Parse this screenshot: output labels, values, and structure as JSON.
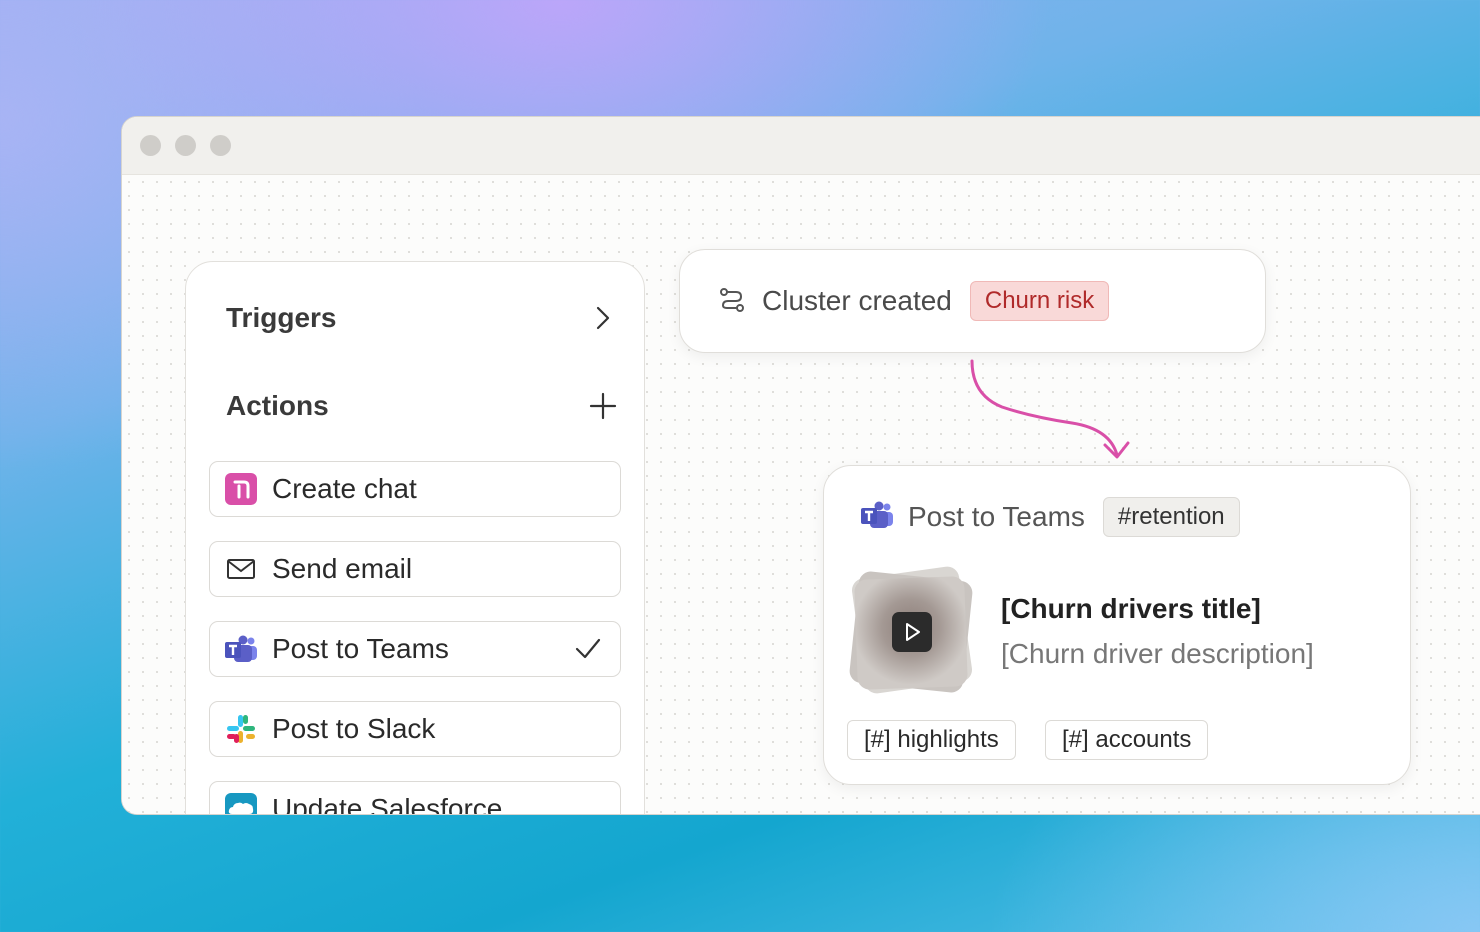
{
  "window": {
    "controls": [
      "close",
      "minimize",
      "maximize"
    ]
  },
  "panel": {
    "triggers_label": "Triggers",
    "actions_label": "Actions",
    "actions": [
      {
        "label": "Create chat",
        "icon": "create-chat-icon",
        "checked": false
      },
      {
        "label": "Send email",
        "icon": "mail-icon",
        "checked": false
      },
      {
        "label": "Post to Teams",
        "icon": "teams-icon",
        "checked": true
      },
      {
        "label": "Post to Slack",
        "icon": "slack-icon",
        "checked": false
      },
      {
        "label": "Update Salesforce",
        "icon": "salesforce-icon",
        "checked": false
      }
    ]
  },
  "trigger_card": {
    "text": "Cluster created",
    "tag": "Churn risk"
  },
  "teams_card": {
    "title": "Post to Teams",
    "channel": "#retention",
    "item_title": "[Churn drivers title]",
    "item_description": "[Churn driver description]",
    "chips": [
      "[#] highlights",
      "[#] accounts"
    ]
  },
  "colors": {
    "accent_pink": "#d94fa8",
    "teams_purple": "#5b5fc7",
    "churn_tag_bg": "#f9d9d8",
    "churn_tag_text": "#b02a2a"
  }
}
